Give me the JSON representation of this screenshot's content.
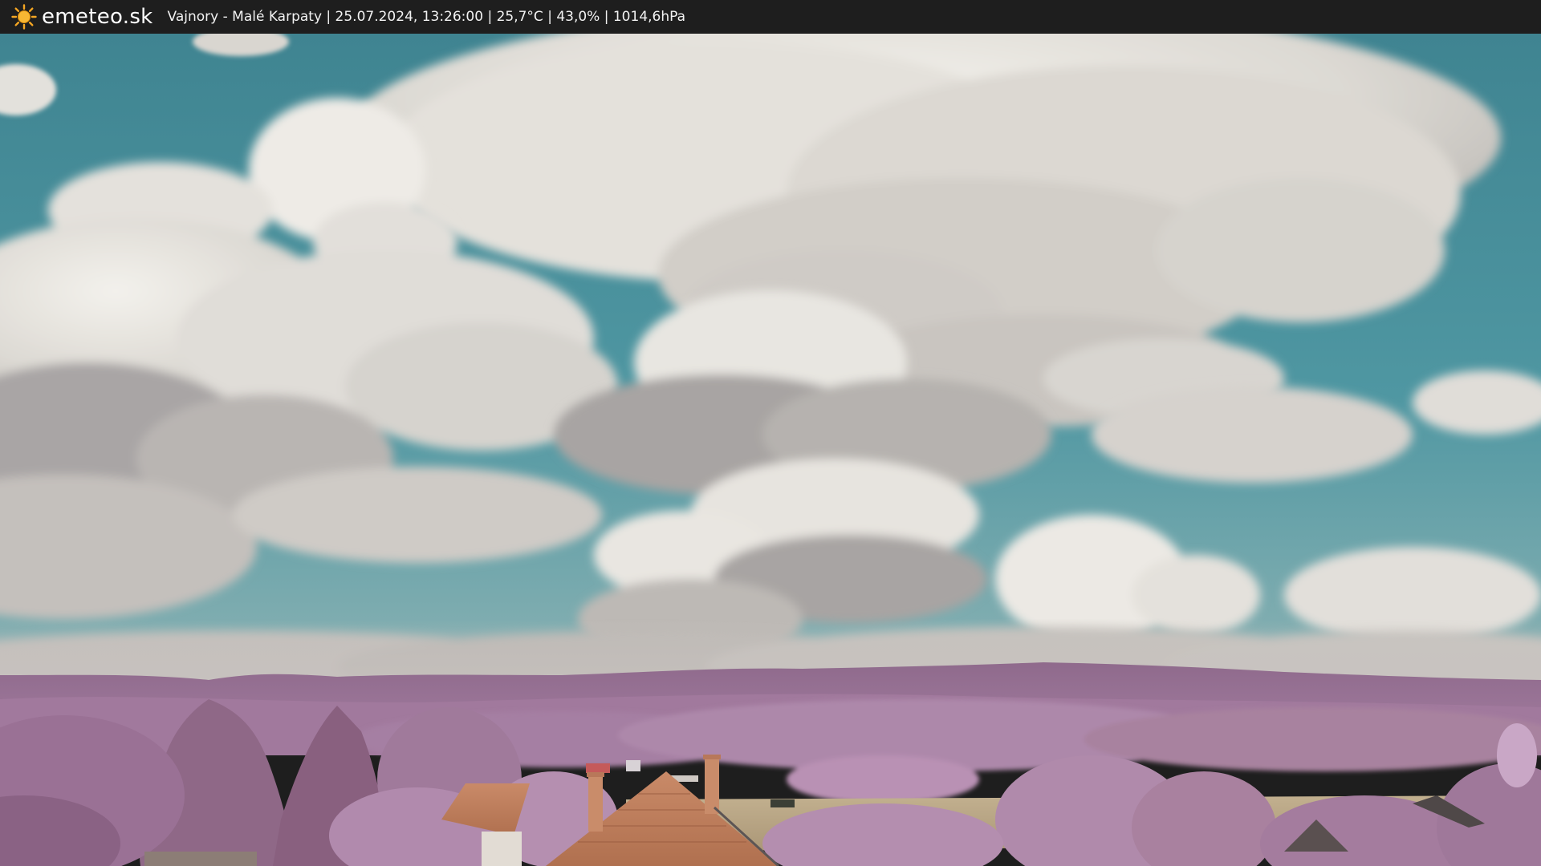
{
  "header": {
    "brand": "emeteo.sk",
    "info": "Vajnory - Malé Karpaty | 25.07.2024, 13:26:00 | 25,7°C | 43,0% | 1014,6hPa",
    "logo_icon": "sun-icon"
  },
  "colors": {
    "bar": "#1e1e1e",
    "sun": "#f5a623",
    "sky": "#4a8f9b",
    "foliage": "#9b6f9a",
    "field": "#b8a482",
    "roof": "#c8805c"
  }
}
